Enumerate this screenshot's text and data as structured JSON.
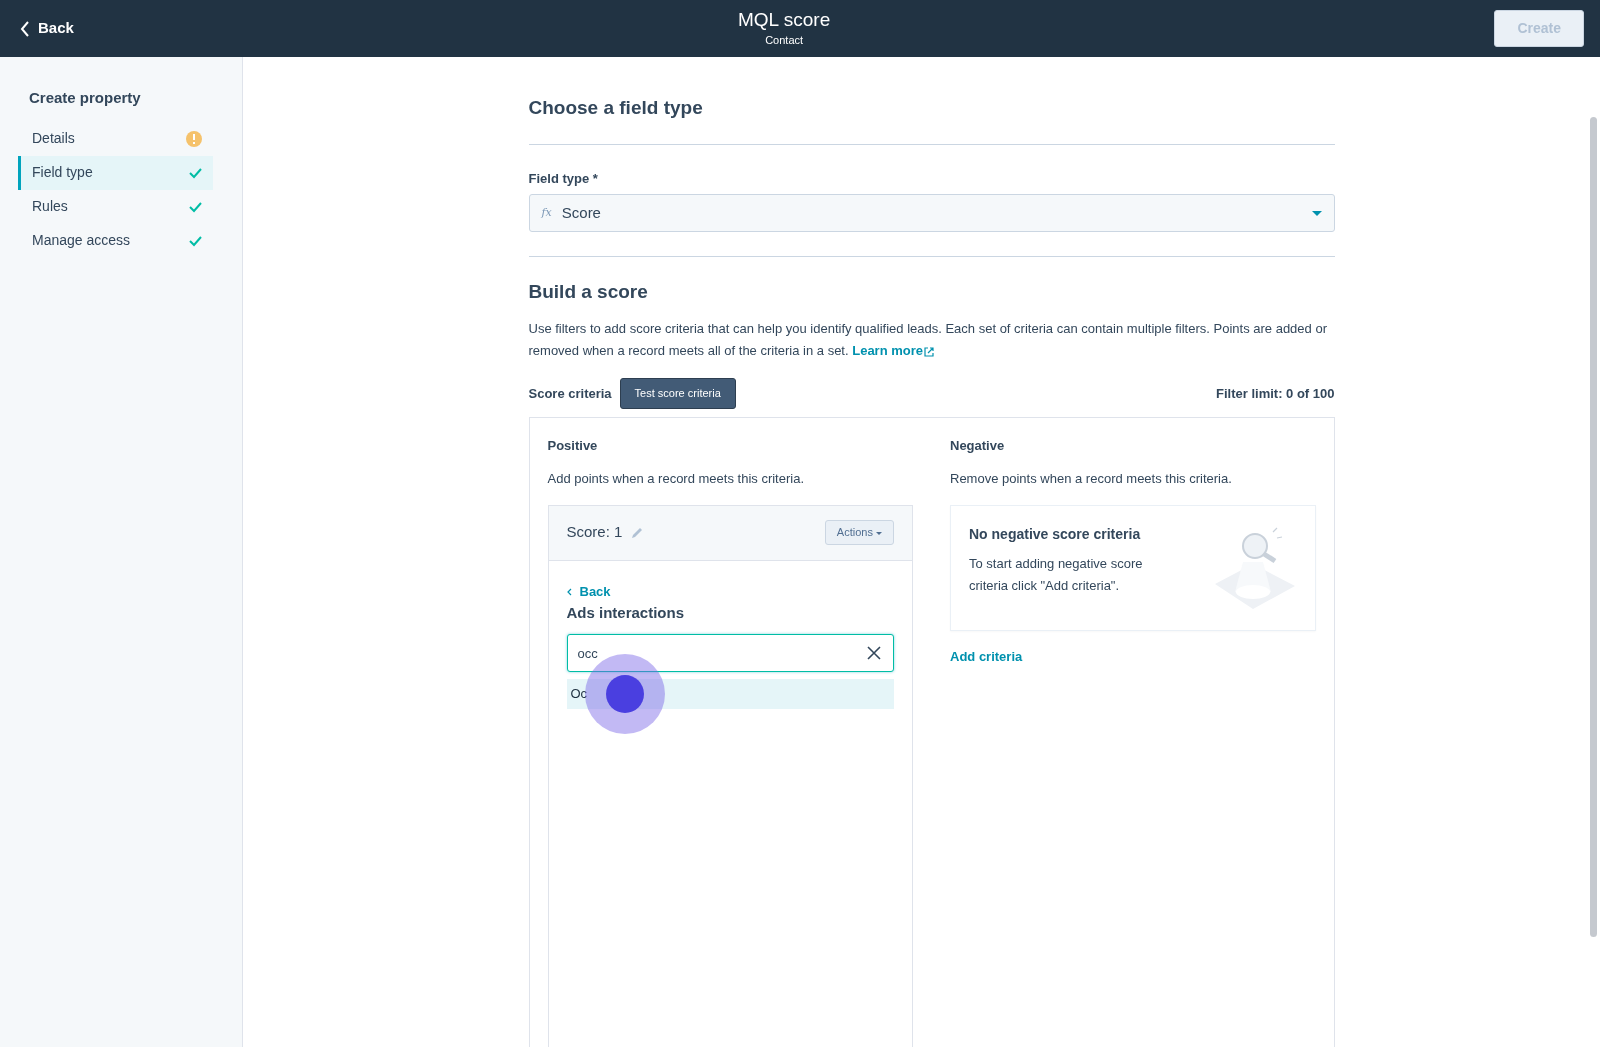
{
  "header": {
    "back": "Back",
    "title": "MQL score",
    "subtitle": "Contact",
    "create_button": {
      "label": "Create",
      "disabled": true
    }
  },
  "sidebar": {
    "title": "Create property",
    "items": [
      {
        "label": "Details",
        "selected": false,
        "complete": false
      },
      {
        "label": "Field type",
        "selected": true,
        "complete": true
      },
      {
        "label": "Rules",
        "selected": false,
        "complete": true
      },
      {
        "label": "Manage access",
        "selected": false,
        "complete": true
      }
    ]
  },
  "field_type_section": {
    "heading": "Choose a field type",
    "label": "Field type *",
    "value_icon": "fx",
    "value": "Score"
  },
  "build_section": {
    "heading": "Build a score",
    "description": "Use filters to add score criteria that can help you identify qualified leads. Each set of criteria can contain multiple filters. Points are added or removed when a record meets all of the criteria in a set.",
    "learn_more": "Learn more",
    "criteria_label": "Score criteria",
    "test_button": "Test score criteria",
    "filter_limit": "Filter limit: 0 of 100"
  },
  "positive": {
    "heading": "Positive",
    "description": "Add points when a record meets this criteria.",
    "score_title": "Score: 1",
    "actions_button": "Actions",
    "back_link": "Back",
    "group_title": "Ads interactions",
    "search_value": "occ",
    "options": [
      {
        "label": "Oc",
        "selected": true
      }
    ]
  },
  "negative": {
    "heading": "Negative",
    "description": "Remove points when a record meets this criteria.",
    "empty_title": "No negative score criteria",
    "empty_text": "To start adding negative score criteria click \"Add criteria\".",
    "add_link": "Add criteria"
  }
}
